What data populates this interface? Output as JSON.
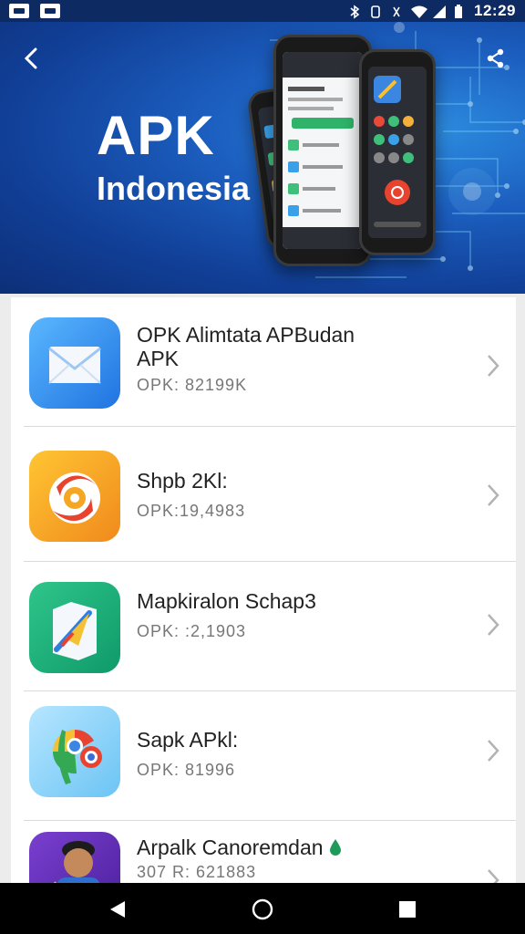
{
  "status_bar": {
    "time": "12:29",
    "left_icons": [
      "notification-icon",
      "notification-icon"
    ],
    "right_icons": [
      "bluetooth-icon",
      "vibrate-icon",
      "wifi-icon",
      "signal-icon",
      "battery-icon"
    ]
  },
  "header": {
    "back_icon": "chevron-left-icon",
    "share_icon": "share-icon",
    "title": "APK",
    "subtitle": "Indonesia"
  },
  "apps": [
    {
      "name": "OPK Alimtata APBudan APK",
      "size": "OPK: 82199K",
      "icon": "mail-icon"
    },
    {
      "name": "Shpb 2Kl:",
      "size": "OPK:19,4983",
      "icon": "swirl-icon"
    },
    {
      "name": "Mapkiralon Schap3",
      "size": "OPK: :2,1903",
      "icon": "maps-icon"
    },
    {
      "name": "Sapk APkl:",
      "size": "OPK: 81996",
      "icon": "chrome-icon"
    },
    {
      "name": "Arpalk Canoremdan",
      "size": "307 R: 621883",
      "icon": "avatar-icon"
    }
  ],
  "colors": {
    "status_bar": "#0d2a63",
    "hero_blue": "#1c5fc0",
    "list_bg": "#ffffff",
    "nav_bar": "#000000"
  },
  "nav": {
    "back_icon": "triangle-back-icon",
    "home_icon": "circle-home-icon",
    "recent_icon": "square-recents-icon"
  }
}
